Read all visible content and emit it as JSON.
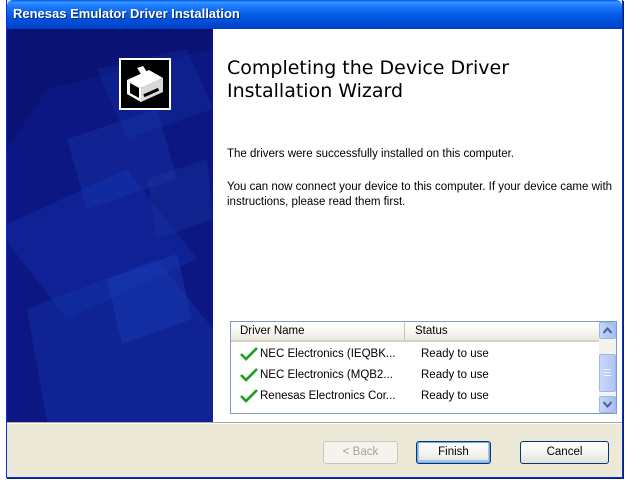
{
  "window": {
    "title": "Renesas Emulator Driver Installation"
  },
  "content": {
    "heading": "Completing the Device Driver Installation Wizard",
    "paragraph1": "The drivers were successfully installed on this computer.",
    "paragraph2": "You can now connect your device to this computer. If your device came with instructions, please read them first."
  },
  "driver_list": {
    "columns": [
      "Driver Name",
      "Status"
    ],
    "rows": [
      {
        "name": "NEC Electronics (IEQBK...",
        "status": "Ready to use",
        "icon": "checkmark-icon"
      },
      {
        "name": "NEC Electronics (MQB2...",
        "status": "Ready to use",
        "icon": "checkmark-icon"
      },
      {
        "name": "Renesas Electronics Cor...",
        "status": "Ready to use",
        "icon": "checkmark-icon"
      }
    ]
  },
  "buttons": {
    "back": "< Back",
    "finish": "Finish",
    "cancel": "Cancel"
  },
  "colors": {
    "titlebar": "#0054e3",
    "banner": "#0a1273",
    "check": "#1e9e1e"
  }
}
